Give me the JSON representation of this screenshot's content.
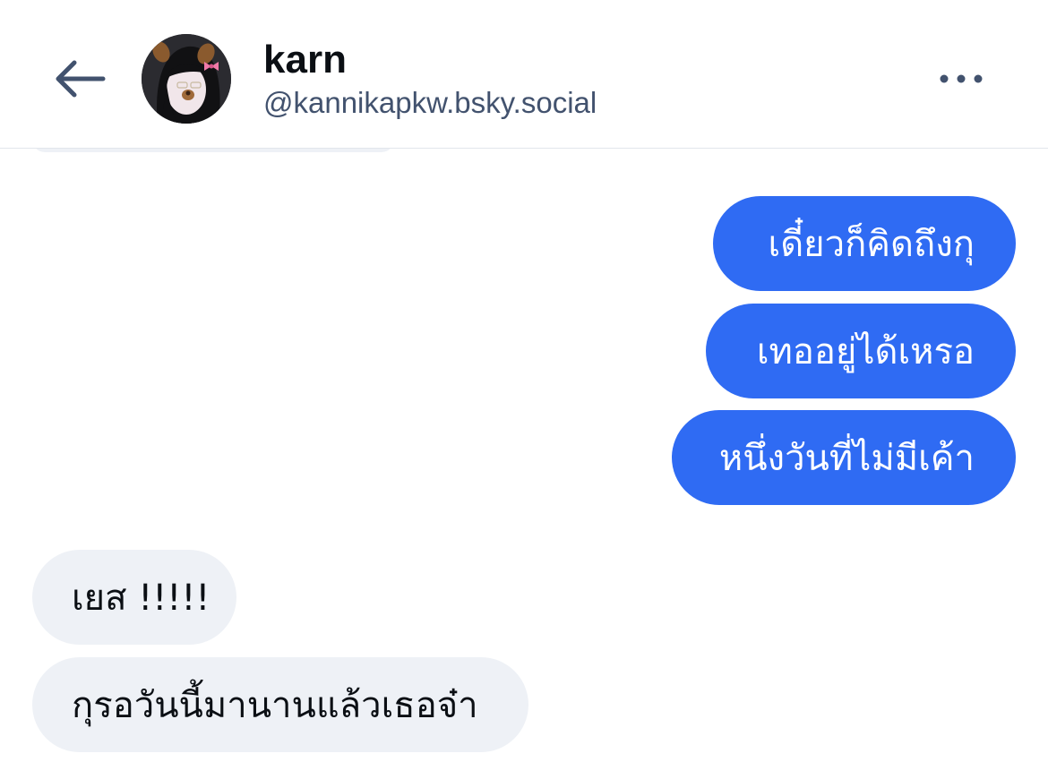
{
  "header": {
    "back_icon": "arrow-left-icon",
    "avatar_alt": "karn",
    "display_name": "karn",
    "handle": "@kannikapkw.bsky.social",
    "more_icon": "more-horizontal-icon"
  },
  "messages": [
    {
      "direction": "sent",
      "text": "เดี๋ยวก็คิดถึงกุ"
    },
    {
      "direction": "sent",
      "text": "เทออยู่ได้เหรอ"
    },
    {
      "direction": "sent",
      "text": "หนึ่งวันที่ไม่มีเค้า"
    },
    {
      "direction": "received",
      "text": "เยส !!!!!"
    },
    {
      "direction": "received",
      "text": "กุรอวันนี้มานานแล้วเธอจ๋า"
    }
  ],
  "colors": {
    "sent_bubble": "#2f6bf3",
    "received_bubble": "#eef1f6",
    "handle_text": "#42526e",
    "icon": "#42526e"
  }
}
